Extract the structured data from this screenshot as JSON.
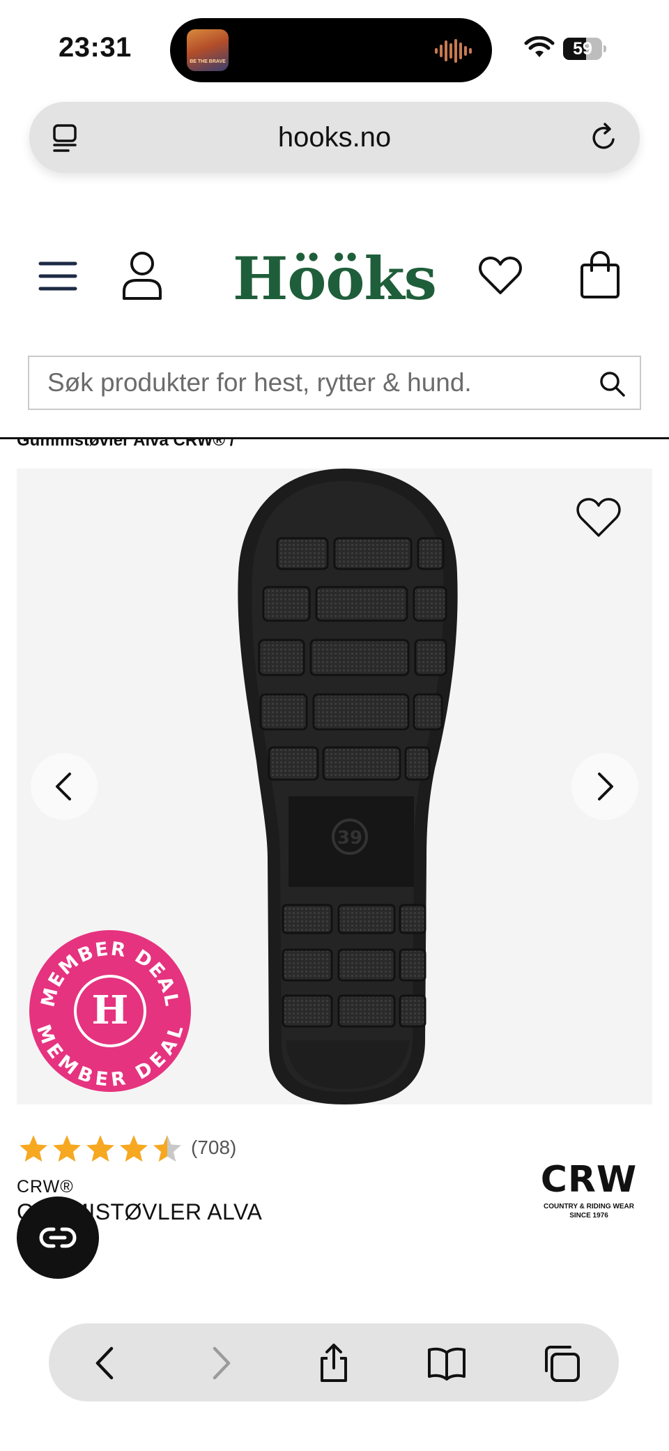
{
  "status_bar": {
    "time": "23:31",
    "battery_level": "59",
    "battery_fraction": 0.59,
    "island_art_text": "BE THE BRAVE"
  },
  "browser": {
    "url": "hooks.no"
  },
  "header": {
    "logo": "Hööks",
    "brand_color": "#1f5e3a"
  },
  "search": {
    "placeholder": "Søk produkter for hest, rytter & hund."
  },
  "breadcrumb": "Gummistøvler Alva CRW® /",
  "product": {
    "badge": {
      "text": "MEMBER DEAL",
      "letter": "H",
      "color": "#e5337f"
    },
    "rating": 4.5,
    "rating_max": 5,
    "review_count": "(708)",
    "brand": "CRW®",
    "title": "GUMMISTØVLER ALVA",
    "brand_logo": {
      "mark": "CRW",
      "tagline": "COUNTRY & RIDING WEAR",
      "since": "SINCE 1976"
    },
    "sole_size": "39"
  },
  "colors": {
    "star": "#f6a821",
    "star_empty": "#c8c8c8"
  }
}
